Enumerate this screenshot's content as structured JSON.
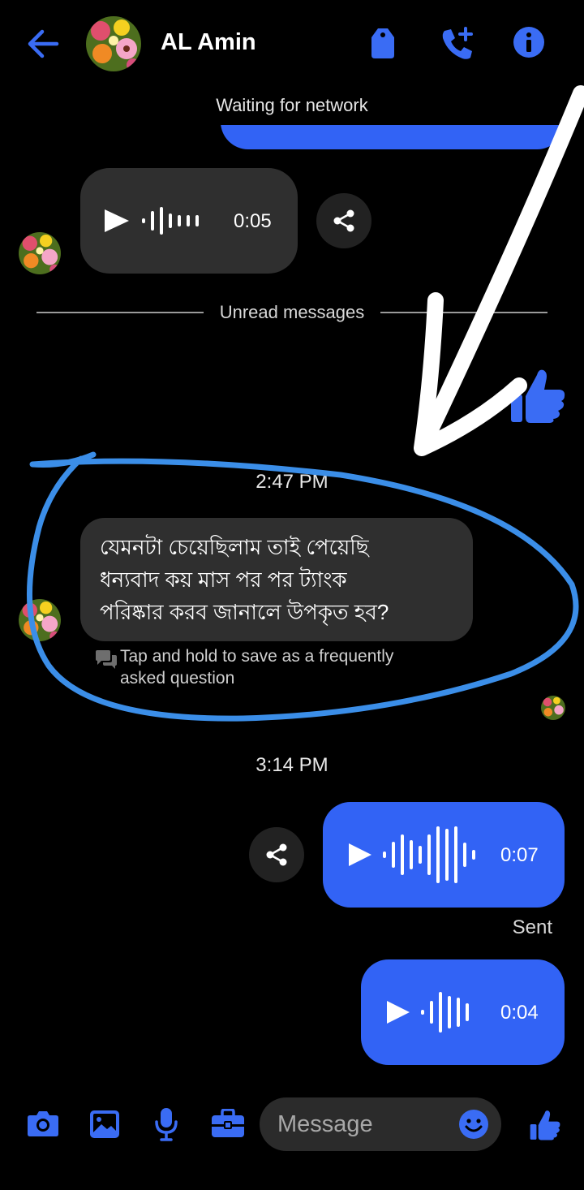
{
  "header": {
    "contact_name": "AL Amin"
  },
  "network_status": "Waiting for network",
  "divider_label": "Unread messages",
  "messages": [
    {
      "type": "audio",
      "direction": "incoming",
      "duration": "0:05"
    },
    {
      "type": "timestamp",
      "text": "2:47 PM"
    },
    {
      "type": "text",
      "direction": "incoming",
      "lines": [
        "যেমনটা চেয়েছিলাম তাই পেয়েছি",
        "ধন্যবাদ কয় মাস পর পর ট্যাংক",
        "পরিষ্কার করব জানালে উপকৃত হব?"
      ]
    },
    {
      "type": "hint",
      "lines": [
        "Tap and hold to save as a frequently",
        "asked question"
      ]
    },
    {
      "type": "timestamp",
      "text": "3:14 PM"
    },
    {
      "type": "audio",
      "direction": "outgoing",
      "duration": "0:07",
      "status": "Sent"
    },
    {
      "type": "audio",
      "direction": "outgoing",
      "duration": "0:04"
    }
  ],
  "composer": {
    "placeholder": "Message"
  },
  "icons": [
    "back-arrow-icon",
    "tag-icon",
    "phone-add-icon",
    "info-icon",
    "share-icon",
    "play-icon",
    "thumbs-up-icon",
    "camera-icon",
    "image-icon",
    "microphone-icon",
    "briefcase-icon",
    "emoji-icon",
    "chat-bubbles-icon"
  ],
  "colors": {
    "accent": "#3263f5",
    "icon_blue": "#3a6cf4",
    "bubble_dark": "#2f2f2f",
    "background": "#000000",
    "annotation_outline": "#3b8ee8"
  }
}
